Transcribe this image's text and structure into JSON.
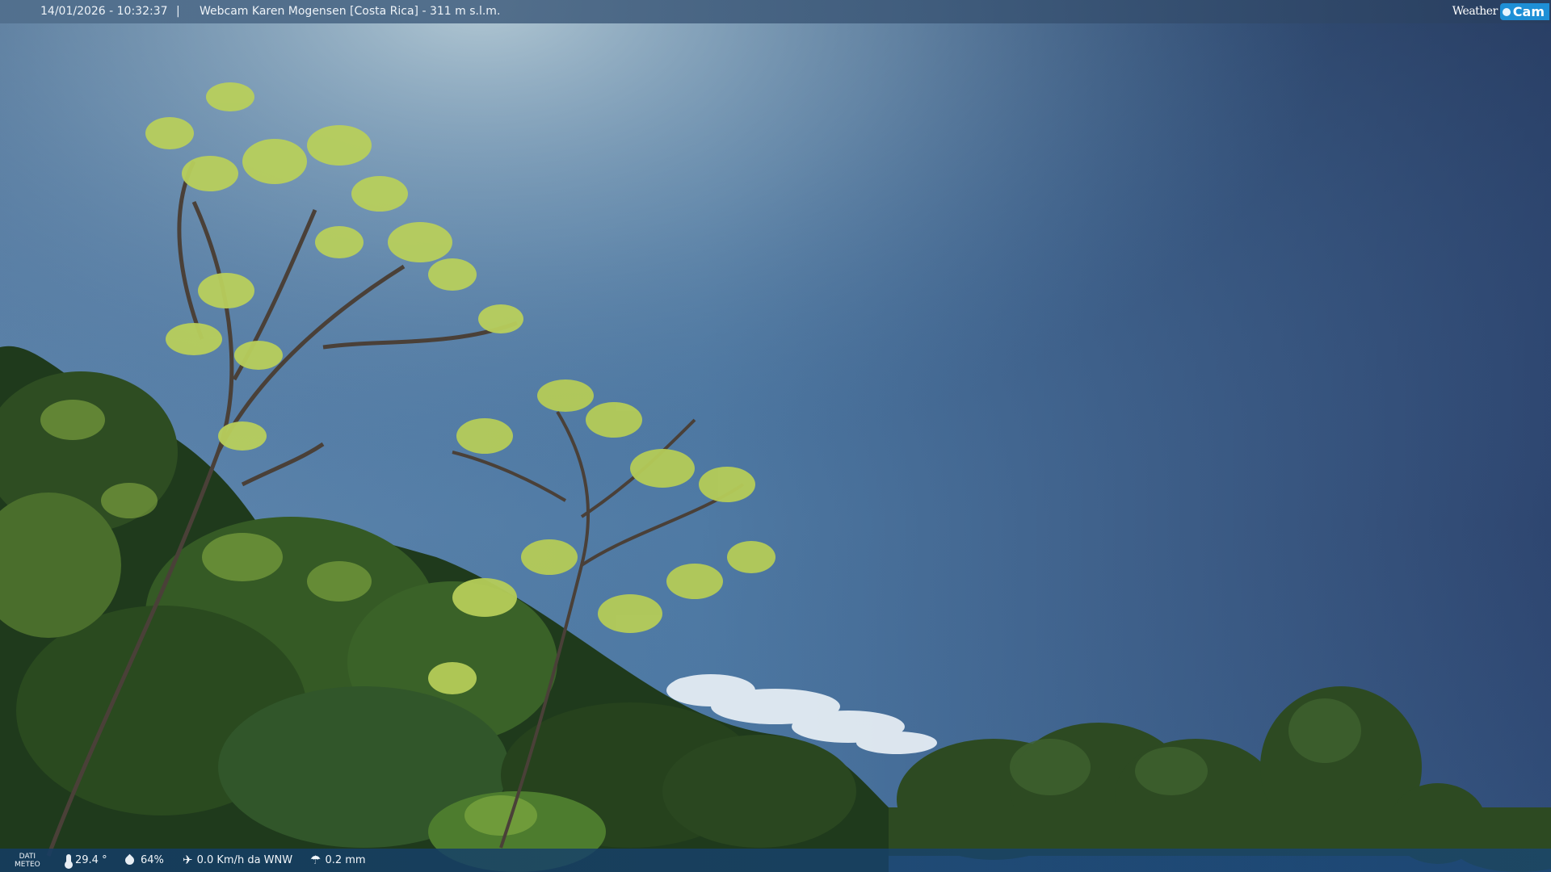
{
  "header": {
    "datetime": "14/01/2026 - 10:32:37",
    "separator": "|",
    "title": "Webcam Karen Mogensen [Costa Rica] - 311 m s.l.m.",
    "logo_left": "Weather",
    "logo_right": "Cam"
  },
  "footer": {
    "dati_line1": "DATI",
    "dati_line2": "METEO",
    "temperature": "29.4 °",
    "humidity": "64%",
    "wind": "0.0 Km/h da WNW",
    "rain": "0.2 mm",
    "icons": [
      "thermometer-icon",
      "humidity-icon",
      "wind-icon",
      "rain-icon"
    ]
  },
  "colors": {
    "sky_light": "#8fb3cc",
    "sky_mid": "#4f7aa4",
    "sky_dark": "#2c4266",
    "foliage_dark": "#1f3a1c",
    "foliage_light": "#9cbf4a",
    "logo_accent": "#1e8fd6"
  }
}
